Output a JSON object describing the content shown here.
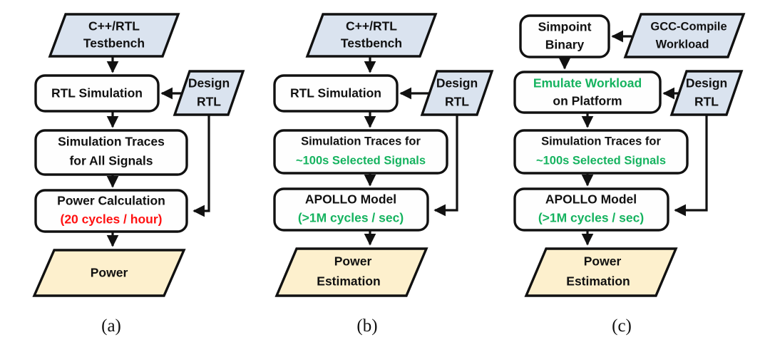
{
  "figure": {
    "type": "flowchart-comparison",
    "background": "#ffffff",
    "colors": {
      "stroke": "#111111",
      "box_fill": "#fefefe",
      "parallelogram_input_fill": "#dae3ef",
      "parallelogram_output_fill": "#fdf0cd",
      "text_default": "#111111",
      "text_green": "#15b35f",
      "text_red": "#ff1111"
    }
  },
  "panels": [
    {
      "id": "a",
      "label": "(a)",
      "nodes": {
        "testbench": {
          "line1": "C++/RTL",
          "line2": "Testbench",
          "shape": "parallelogram",
          "fill": "input"
        },
        "rtl_simulation": {
          "line1": "RTL Simulation",
          "shape": "rounded-box"
        },
        "design_rtl": {
          "line1": "Design",
          "line2": "RTL",
          "shape": "parallelogram",
          "fill": "input"
        },
        "traces": {
          "line1": "Simulation Traces",
          "line2": "for All Signals",
          "shape": "rounded-box"
        },
        "power_calculation": {
          "line1": "Power Calculation",
          "line2": "(20 cycles / hour)",
          "line2_color": "red",
          "shape": "rounded-box"
        },
        "power_output": {
          "line1": "Power",
          "shape": "parallelogram",
          "fill": "output"
        }
      }
    },
    {
      "id": "b",
      "label": "(b)",
      "nodes": {
        "testbench": {
          "line1": "C++/RTL",
          "line2": "Testbench",
          "shape": "parallelogram",
          "fill": "input"
        },
        "rtl_simulation": {
          "line1": "RTL Simulation",
          "shape": "rounded-box"
        },
        "design_rtl": {
          "line1": "Design",
          "line2": "RTL",
          "shape": "parallelogram",
          "fill": "input"
        },
        "traces": {
          "line1": "Simulation Traces for",
          "line2": "~100s Selected Signals",
          "line2_color": "green",
          "shape": "rounded-box"
        },
        "apollo_model": {
          "line1": "APOLLO Model",
          "line2": "(>1M cycles / sec)",
          "line2_color": "green",
          "shape": "rounded-box"
        },
        "power_output": {
          "line1": "Power",
          "line2": "Estimation",
          "shape": "parallelogram",
          "fill": "output"
        }
      }
    },
    {
      "id": "c",
      "label": "(c)",
      "nodes": {
        "simpoint_binary": {
          "line1": "Simpoint",
          "line2": "Binary",
          "shape": "rounded-box"
        },
        "gcc_workload": {
          "line1": "GCC-Compile",
          "line2": "Workload",
          "shape": "parallelogram",
          "fill": "input"
        },
        "emulate": {
          "line1": "Emulate Workload",
          "line1_color": "green",
          "line2": "on Platform",
          "shape": "rounded-box"
        },
        "design_rtl": {
          "line1": "Design",
          "line2": "RTL",
          "shape": "parallelogram",
          "fill": "input"
        },
        "traces": {
          "line1": "Simulation Traces for",
          "line2": "~100s Selected Signals",
          "line2_color": "green",
          "shape": "rounded-box"
        },
        "apollo_model": {
          "line1": "APOLLO Model",
          "line2": "(>1M cycles / sec)",
          "line2_color": "green",
          "shape": "rounded-box"
        },
        "power_output": {
          "line1": "Power",
          "line2": "Estimation",
          "shape": "parallelogram",
          "fill": "output"
        }
      }
    }
  ]
}
